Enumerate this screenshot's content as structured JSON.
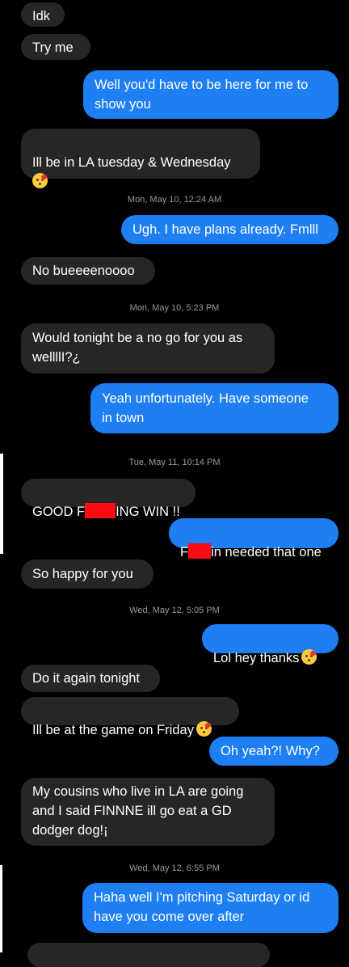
{
  "messages": [
    {
      "text": "Idk"
    },
    {
      "text": "Try me"
    },
    {
      "text": "Well you'd have to be here for me to\nshow you"
    },
    {
      "text": "Ill be in LA tuesday & Wednesday\n"
    },
    {
      "text": "Ugh. I have plans already. Fmlll"
    },
    {
      "text": "No bueeeenoooo"
    },
    {
      "text": "Would tonight be a no go for you as\nwellllI?¿"
    },
    {
      "text": "Yeah unfortunately. Have someone\nin town"
    },
    {
      "pre": "GOOD F",
      "post": "ING WIN !!"
    },
    {
      "pre": "F",
      "post": "in needed that one"
    },
    {
      "text": "So happy for you"
    },
    {
      "text": "Lol hey thanks"
    },
    {
      "text": "Do it again tonight"
    },
    {
      "text": "Ill be at the game on Friday"
    },
    {
      "text": "Oh yeah?! Why?"
    },
    {
      "text": "My cousins who live in LA are going\nand I said FINNNE ill go eat a GD\ndodger dog!¡"
    },
    {
      "text": "Haha well I'm pitching Saturday or id\nhave you come over after"
    }
  ],
  "timestamps": [
    "Mon, May 10, 12:24 AM",
    "Mon, May 10, 5:23 PM",
    "Tue, May 11, 10:14 PM",
    "Wed, May 12, 5:05 PM",
    "Wed, May 12, 6:55 PM"
  ],
  "emoji": "face-blowing-a-kiss",
  "colors": {
    "incoming": "#262626",
    "outgoing": "#1e7ff5",
    "redaction": "#ff0b14"
  }
}
